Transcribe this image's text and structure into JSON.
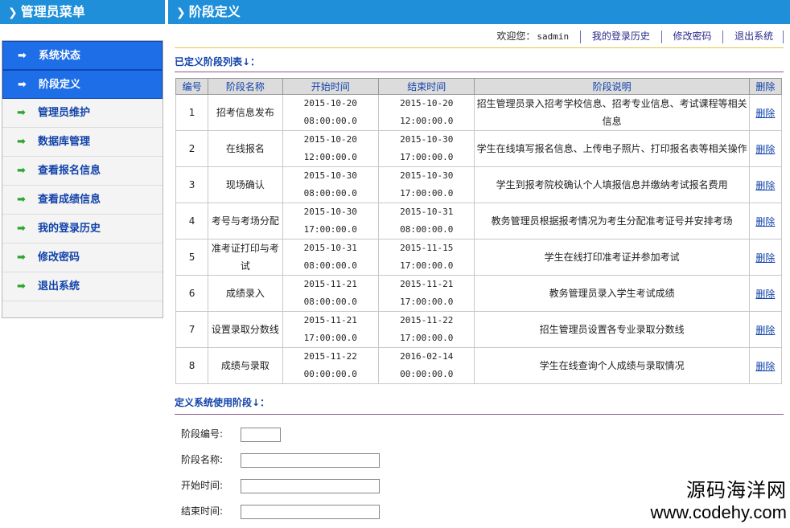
{
  "sidebar": {
    "title": "管理员菜单",
    "items": [
      {
        "label": "系统状态",
        "active": true
      },
      {
        "label": "阶段定义",
        "active": true
      },
      {
        "label": "管理员维护",
        "active": false
      },
      {
        "label": "数据库管理",
        "active": false
      },
      {
        "label": "查看报名信息",
        "active": false
      },
      {
        "label": "查看成绩信息",
        "active": false
      },
      {
        "label": "我的登录历史",
        "active": false
      },
      {
        "label": "修改密码",
        "active": false
      },
      {
        "label": "退出系统",
        "active": false
      }
    ]
  },
  "main": {
    "title": "阶段定义"
  },
  "topbar": {
    "welcome": "欢迎您：",
    "user": "sadmin",
    "history": "我的登录历史",
    "password": "修改密码",
    "logout": "退出系统"
  },
  "list_section": {
    "title": "已定义阶段列表↓："
  },
  "table": {
    "headers": [
      "编号",
      "阶段名称",
      "开始时间",
      "结束时间",
      "阶段说明",
      "删除"
    ],
    "rows": [
      {
        "id": "1",
        "name": "招考信息发布",
        "start_date": "2015-10-20",
        "start_time": "08:00:00.0",
        "end_date": "2015-10-20",
        "end_time": "12:00:00.0",
        "desc": "招生管理员录入招考学校信息、招考专业信息、考试课程等相关信息",
        "del": "删除"
      },
      {
        "id": "2",
        "name": "在线报名",
        "start_date": "2015-10-20",
        "start_time": "12:00:00.0",
        "end_date": "2015-10-30",
        "end_time": "17:00:00.0",
        "desc": "学生在线填写报名信息、上传电子照片、打印报名表等相关操作",
        "del": "删除"
      },
      {
        "id": "3",
        "name": "现场确认",
        "start_date": "2015-10-30",
        "start_time": "08:00:00.0",
        "end_date": "2015-10-30",
        "end_time": "17:00:00.0",
        "desc": "学生到报考院校确认个人填报信息并缴纳考试报名费用",
        "del": "删除"
      },
      {
        "id": "4",
        "name": "考号与考场分配",
        "start_date": "2015-10-30",
        "start_time": "17:00:00.0",
        "end_date": "2015-10-31",
        "end_time": "08:00:00.0",
        "desc": "教务管理员根据报考情况为考生分配准考证号并安排考场",
        "del": "删除"
      },
      {
        "id": "5",
        "name": "准考证打印与考试",
        "start_date": "2015-10-31",
        "start_time": "08:00:00.0",
        "end_date": "2015-11-15",
        "end_time": "17:00:00.0",
        "desc": "学生在线打印准考证并参加考试",
        "del": "删除"
      },
      {
        "id": "6",
        "name": "成绩录入",
        "start_date": "2015-11-21",
        "start_time": "08:00:00.0",
        "end_date": "2015-11-21",
        "end_time": "17:00:00.0",
        "desc": "教务管理员录入学生考试成绩",
        "del": "删除"
      },
      {
        "id": "7",
        "name": "设置录取分数线",
        "start_date": "2015-11-21",
        "start_time": "17:00:00.0",
        "end_date": "2015-11-22",
        "end_time": "17:00:00.0",
        "desc": "招生管理员设置各专业录取分数线",
        "del": "删除"
      },
      {
        "id": "8",
        "name": "成绩与录取",
        "start_date": "2015-11-22",
        "start_time": "00:00:00.0",
        "end_date": "2016-02-14",
        "end_time": "00:00:00.0",
        "desc": "学生在线查询个人成绩与录取情况",
        "del": "删除"
      }
    ]
  },
  "form_section": {
    "title": "定义系统使用阶段↓：",
    "fields": [
      {
        "label": "阶段编号:",
        "value": ""
      },
      {
        "label": "阶段名称:",
        "value": ""
      },
      {
        "label": "开始时间:",
        "value": ""
      },
      {
        "label": "结束时间:",
        "value": ""
      }
    ]
  },
  "watermark": {
    "cn": "源码海洋网",
    "url": "www.codehy.com"
  },
  "colors": {
    "header_blue": "#1e8fd8",
    "active_blue": "#1e6ee8",
    "link_blue": "#1142aa"
  }
}
